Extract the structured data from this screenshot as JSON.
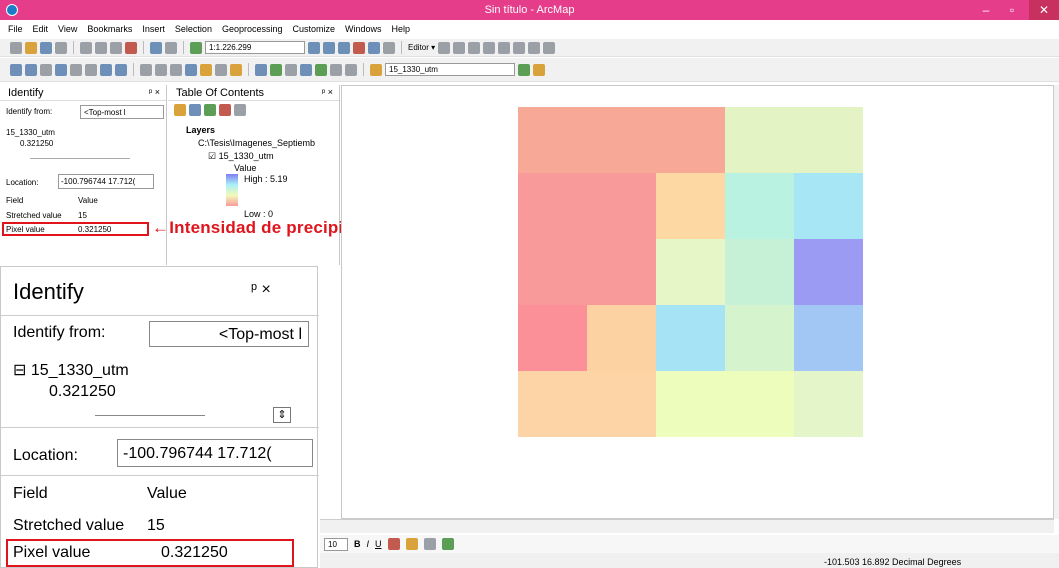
{
  "window": {
    "title": "Sin título - ArcMap",
    "minimize": "–",
    "restore": "▫",
    "close": "✕"
  },
  "menu": [
    "File",
    "Edit",
    "View",
    "Bookmarks",
    "Insert",
    "Selection",
    "Geoprocessing",
    "Customize",
    "Windows",
    "Help"
  ],
  "toolbar": {
    "scale": "1:1.226.299",
    "editor": "Editor ▾",
    "layer_combo": "15_1330_utm"
  },
  "identify_small": {
    "title": "Identify",
    "pin": "ᵖ ×",
    "identify_from_label": "Identify from:",
    "identify_from_value": "<Top-most l",
    "tree_root": "15_1330_utm",
    "tree_child": "0.321250",
    "location_label": "Location:",
    "location_value": "-100.796744  17.712(",
    "field_header": "Field",
    "value_header": "Value",
    "rows": [
      {
        "field": "Stretched value",
        "value": "15"
      },
      {
        "field": "Pixel value",
        "value": "0.321250"
      }
    ]
  },
  "toc": {
    "title": "Table Of Contents",
    "pin": "ᵖ ×",
    "layers": "Layers",
    "folder": "C:\\Tesis\\Imagenes_Septiemb",
    "layer": "15_1330_utm",
    "value_label": "Value",
    "high": "High : 5.19",
    "low": "Low : 0"
  },
  "annotation": "←Intensidad de precipitación",
  "identify_large": {
    "title": "Identify",
    "pin": "ᵖ ×",
    "identify_from_label": "Identify from:",
    "identify_from_value": "<Top-most l",
    "tree_root": "15_1330_utm",
    "tree_child": "0.321250",
    "location_label": "Location:",
    "location_value": "-100.796744  17.712(",
    "field_header": "Field",
    "value_header": "Value",
    "rows": [
      {
        "field": "Stretched value",
        "value": "15"
      },
      {
        "field": "Pixel value",
        "value": "0.321250"
      }
    ]
  },
  "drawbar": {
    "font_size": "10",
    "bold": "B",
    "italic": "I",
    "underline": "U"
  },
  "status": {
    "coords": "-101.503  16.892 Decimal Degrees"
  },
  "raster": {
    "cells": [
      [
        "#f8a896",
        "#f8a896",
        "#f8a896",
        "#e3f3c4",
        "#e3f3c4"
      ],
      [
        "#f8999a",
        "#f8999a",
        "#fdd8a2",
        "#b9f2e0",
        "#a6e6f5"
      ],
      [
        "#f8999a",
        "#f8999a",
        "#e6f6c6",
        "#c7f1d6",
        "#9b9bf3"
      ],
      [
        "#fc9099",
        "#fcd2a2",
        "#a6e3f5",
        "#d5f4cd",
        "#a2c7f5"
      ],
      [
        "#fcd4a5",
        "#fcd4a5",
        "#edfdbb",
        "#edfdbb",
        "#e3f5c9"
      ]
    ]
  }
}
